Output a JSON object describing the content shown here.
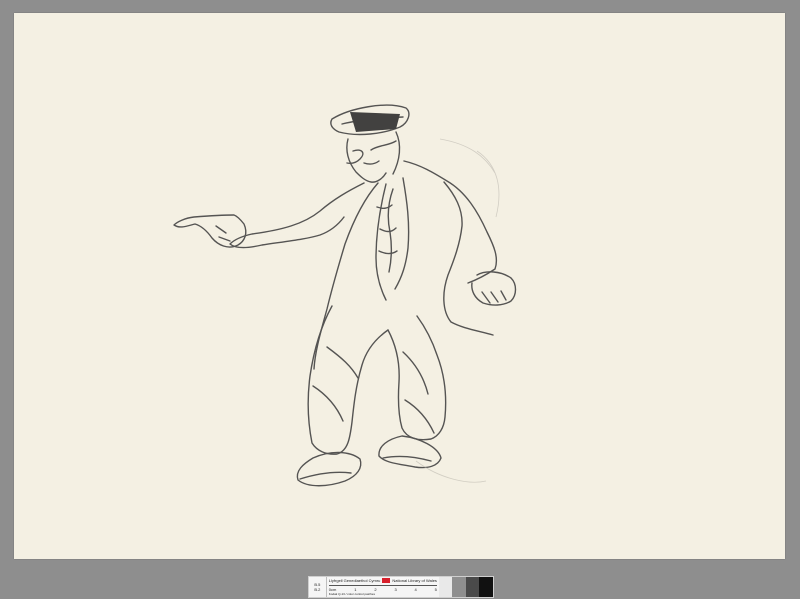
{
  "scan": {
    "background_color": "#8e8e8e",
    "paper_color": "#f4f0e3"
  },
  "target_strip": {
    "ruler_left": "0.5\n1.0",
    "ruler_left_top": "B.5",
    "ruler_left_bottom": "B.2",
    "institution_label_cy": "Llyfrgell Genedlaethol Cymru",
    "institution_label_en": "National Library of Wales",
    "scale_ticks": [
      "0cm",
      "1",
      "2",
      "3",
      "4",
      "5"
    ],
    "fine_print": "Kodak Q-13 / color control patches",
    "gray_patch_colors": [
      "#e9e9e9",
      "#8f8f8f",
      "#4a4a4a",
      "#111111"
    ]
  }
}
